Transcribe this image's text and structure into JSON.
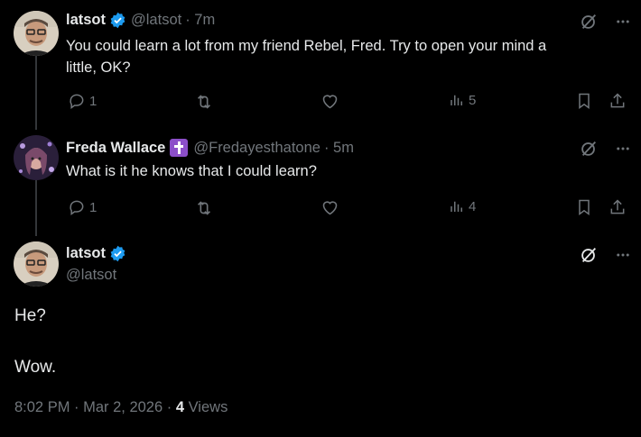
{
  "tweets": [
    {
      "display_name": "latsot",
      "handle": "@latsot",
      "time": "· 7m",
      "text_line1": "You could learn a lot from my friend Rebel, Fred. Try to open your mind a",
      "text_line2": "little, OK?",
      "replies": "1",
      "views": "5",
      "verified": true
    },
    {
      "display_name": "Freda Wallace",
      "handle": "@Fredayesthatone",
      "time": "· 5m",
      "text": "What is it he knows that I could learn?",
      "replies": "1",
      "views": "4",
      "badge": "cross-icon"
    }
  ],
  "main_tweet": {
    "display_name": "latsot",
    "handle": "@latsot",
    "text_line1": "He?",
    "text_line2": "Wow.",
    "timestamp": "8:02 PM · Mar 2, 2026 · ",
    "views_count": "4",
    "views_label": " Views"
  },
  "icons": {
    "grok": "grok-icon",
    "more": "more-icon",
    "reply": "reply-icon",
    "retweet": "retweet-icon",
    "like": "like-icon",
    "views": "views-icon",
    "bookmark": "bookmark-icon",
    "share": "share-icon"
  },
  "colors": {
    "background": "#000000",
    "text": "#e7e9ea",
    "muted": "#71767b",
    "verified": "#1d9bf0",
    "badge": "#8c4fc9"
  }
}
